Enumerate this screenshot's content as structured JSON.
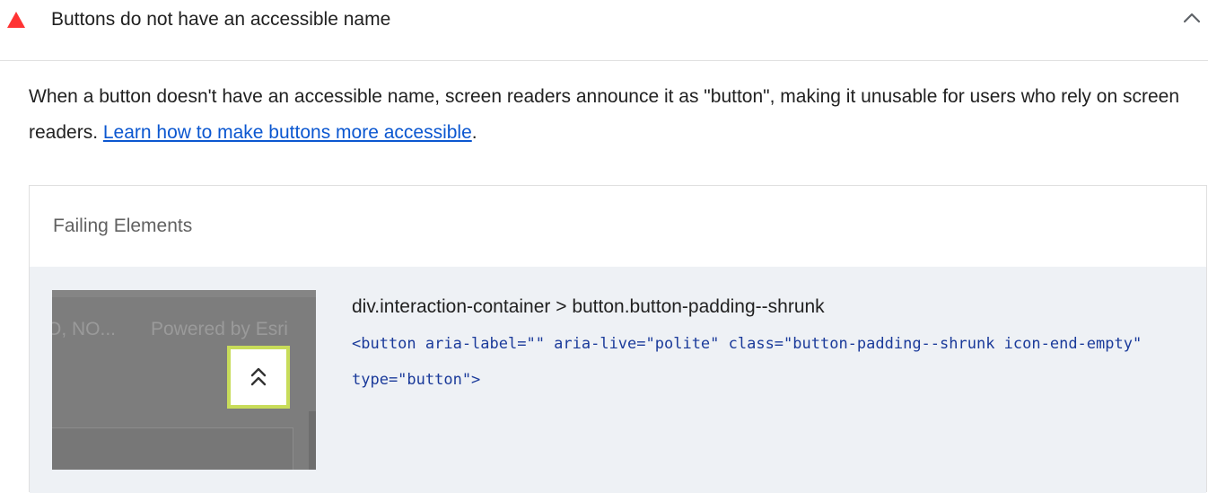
{
  "audit": {
    "title": "Buttons do not have an accessible name",
    "status_color": "#ff3333",
    "status_icon": "fail-triangle-icon",
    "toggle_icon": "chevron-up-icon"
  },
  "description": {
    "text": "When a button doesn't have an accessible name, screen readers announce it as \"button\", making it unusable for users who rely on screen readers. ",
    "link_text": "Learn how to make buttons more accessible",
    "trailing": ".",
    "link_color": "#0b57d0"
  },
  "failing_elements": {
    "header": "Failing Elements",
    "items": [
      {
        "selector": "div.interaction-container > button.button-padding--shrunk",
        "snippet": "<button aria-label=\"\" aria-live=\"polite\" class=\"button-padding--shrunk icon-end-empty\" type=\"button\">",
        "thumbnail": {
          "text_left": "O, NO...",
          "text_right": "Powered by Esri",
          "highlight_icon": "double-chevron-up-icon",
          "highlight_color": "#c8dc5a"
        }
      }
    ]
  }
}
